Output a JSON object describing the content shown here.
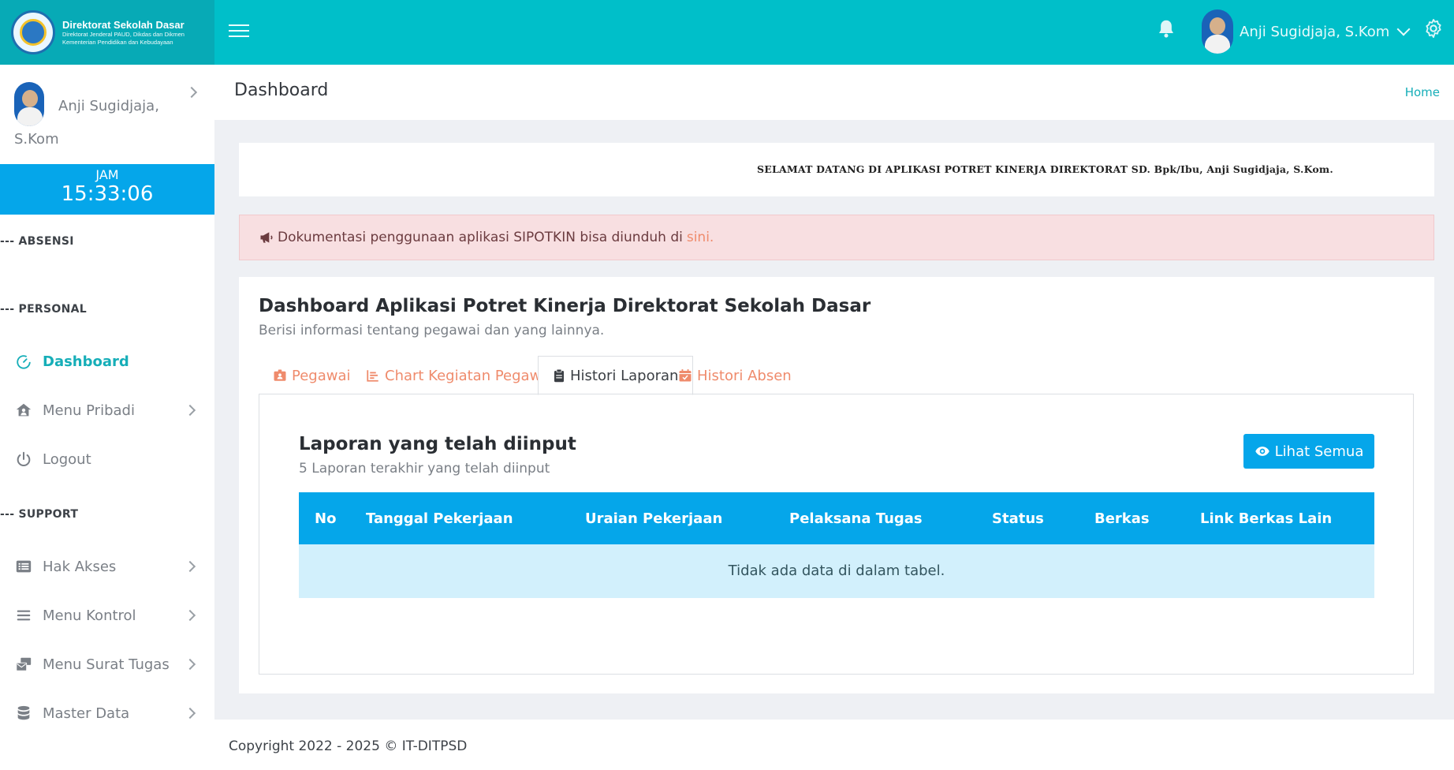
{
  "brand": {
    "title": "Direktorat Sekolah Dasar",
    "subtitle_1": "Direktorat Jenderal PAUD, Dikdas dan Dikmen",
    "subtitle_2": "Kementerian Pendidikan dan Kebudayaan"
  },
  "header": {
    "user_name": "Anji Sugidjaja, S.Kom"
  },
  "sidebar": {
    "user_name": "Anji Sugidjaja, S.Kom",
    "clock_label": "JAM",
    "clock_time": "15:33:06",
    "sections": {
      "absensi": "--- ABSENSI",
      "personal": "--- PERSONAL",
      "support": "--- SUPPORT"
    },
    "items": [
      {
        "label": "Dashboard",
        "icon": "gauge-icon"
      },
      {
        "label": "Menu Pribadi",
        "icon": "home-user-icon"
      },
      {
        "label": "Logout",
        "icon": "power-icon"
      },
      {
        "label": "Hak Akses",
        "icon": "list-icon"
      },
      {
        "label": "Menu Kontrol",
        "icon": "bars-icon"
      },
      {
        "label": "Menu Surat Tugas",
        "icon": "mail-bulk-icon"
      },
      {
        "label": "Master Data",
        "icon": "database-icon"
      }
    ]
  },
  "page": {
    "title": "Dashboard",
    "breadcrumb": "Home"
  },
  "welcome": {
    "text": "SELAMAT DATANG DI APLIKASI POTRET KINERJA DIREKTORAT SD. Bpk/Ibu, Anji Sugidjaja, S.Kom."
  },
  "alert": {
    "text": "Dokumentasi penggunaan aplikasi SIPOTKIN bisa diunduh di",
    "link": "sini."
  },
  "card": {
    "title": "Dashboard Aplikasi Potret Kinerja Direktorat Sekolah Dasar",
    "subtitle": "Berisi informasi tentang pegawai dan yang lainnya.",
    "tabs": [
      {
        "label": "Pegawai",
        "icon": "id-badge-icon"
      },
      {
        "label": "Chart Kegiatan Pegawai",
        "icon": "chart-icon"
      },
      {
        "label": "Histori Laporan",
        "icon": "clipboard-icon"
      },
      {
        "label": "Histori Absen",
        "icon": "calendar-check-icon"
      }
    ]
  },
  "panel": {
    "title": "Laporan yang telah diinput",
    "subtitle": "5 Laporan terakhir yang telah diinput",
    "button": "Lihat Semua",
    "columns": [
      "No",
      "Tanggal Pekerjaan",
      "Uraian Pekerjaan",
      "Pelaksana Tugas",
      "Status",
      "Berkas",
      "Link Berkas Lain"
    ],
    "empty": "Tidak ada data di dalam tabel."
  },
  "footer": {
    "text": "Copyright 2022 - 2025 © IT-DITPSD"
  }
}
